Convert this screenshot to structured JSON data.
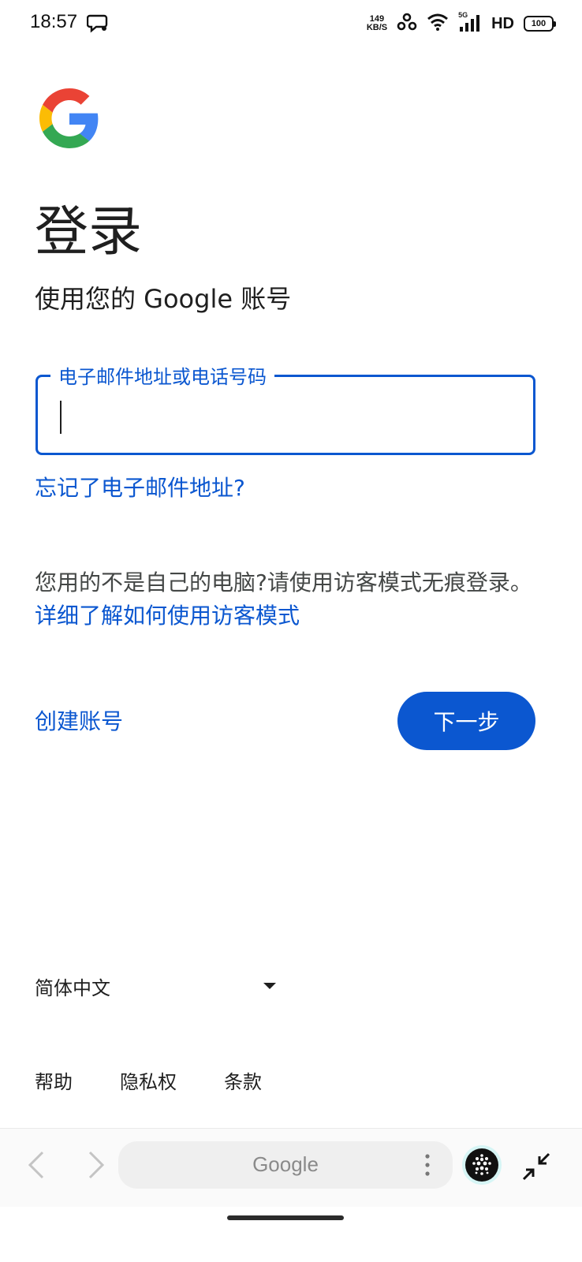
{
  "status_bar": {
    "time": "18:57",
    "net_speed_value": "149",
    "net_speed_unit": "KB/S",
    "signal_label": "5G",
    "hd_label": "HD",
    "battery": "100"
  },
  "signin": {
    "title": "登录",
    "subtitle": "使用您的 Google 账号",
    "email_label": "电子邮件地址或电话号码",
    "email_value": "",
    "forgot_email": "忘记了电子邮件地址?",
    "guest_text": "您用的不是自己的电脑?请使用访客模式无痕登录。",
    "guest_link": "详细了解如何使用访客模式",
    "create_account": "创建账号",
    "next_button": "下一步"
  },
  "footer": {
    "language": "简体中文",
    "links": [
      "帮助",
      "隐私权",
      "条款"
    ]
  },
  "browser": {
    "address_text": "Google"
  },
  "colors": {
    "accent": "#0b57d0",
    "google_blue": "#4285F4",
    "google_red": "#EA4335",
    "google_yellow": "#FBBC05",
    "google_green": "#34A853"
  }
}
